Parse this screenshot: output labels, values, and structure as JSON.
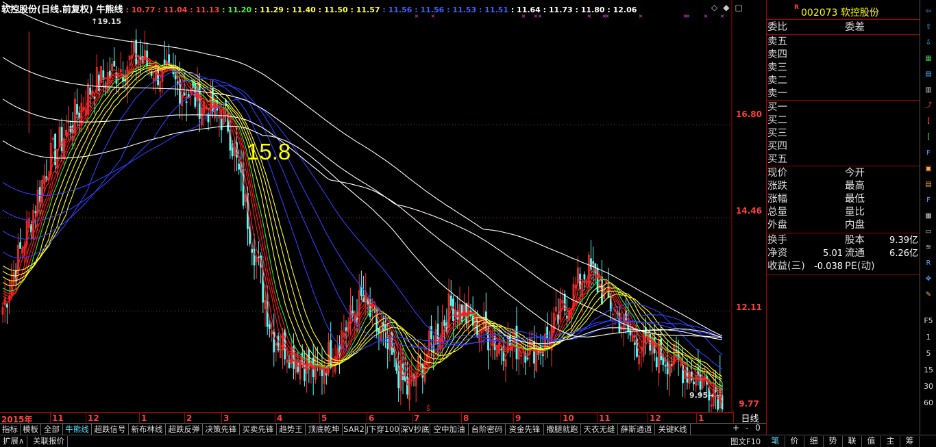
{
  "chart_title": {
    "name": "软控股份(日线.前复权) 牛熊线",
    "ma_values": [
      {
        "text": "10.77",
        "color": "#ff4040"
      },
      {
        "text": "11.04",
        "color": "#ff4040"
      },
      {
        "text": "11.13",
        "color": "#ff4040"
      },
      {
        "text": "11.20",
        "color": "#40ff40"
      },
      {
        "text": "11.29",
        "color": "#ffff40"
      },
      {
        "text": "11.40",
        "color": "#ffff40"
      },
      {
        "text": "11.50",
        "color": "#ffff40"
      },
      {
        "text": "11.57",
        "color": "#ffff40"
      },
      {
        "text": "11.56",
        "color": "#4060ff"
      },
      {
        "text": "11.56",
        "color": "#4060ff"
      },
      {
        "text": "11.53",
        "color": "#4060ff"
      },
      {
        "text": "11.51",
        "color": "#4060ff"
      },
      {
        "text": "11.64",
        "color": "#ffffff"
      },
      {
        "text": "11.73",
        "color": "#ffffff"
      },
      {
        "text": "11.80",
        "color": "#ffffff"
      },
      {
        "text": "12.06",
        "color": "#ffffff"
      }
    ]
  },
  "chart_controls": {
    "diamond": "◇",
    "diamond_filled": "◆",
    "square": "□"
  },
  "big_label": "15.8",
  "peak_label": "19.15",
  "low_label": "9.95",
  "price_axis": [
    "16.80",
    "14.46",
    "12.11",
    "9.77"
  ],
  "date_axis": [
    "2015年",
    "11",
    "12",
    "1",
    "2",
    "3",
    "4",
    "5",
    "6",
    "7",
    "8",
    "9",
    "10",
    "11",
    "12",
    "1"
  ],
  "period": "日线",
  "chart_data": {
    "type": "candlestick",
    "title": "软控股份(日线.前复权) 牛熊线",
    "ylim": [
      9.77,
      19.6
    ],
    "y_ticks": [
      9.77,
      12.11,
      14.46,
      16.8
    ],
    "high": 19.15,
    "low": 9.95,
    "x_labels": [
      "2015年",
      "11",
      "12",
      "1",
      "2",
      "3",
      "4",
      "5",
      "6",
      "7",
      "8",
      "9",
      "10",
      "11",
      "12",
      "1"
    ],
    "ma_last": [
      10.77,
      11.04,
      11.13,
      11.2,
      11.29,
      11.4,
      11.5,
      11.57,
      11.56,
      11.56,
      11.53,
      11.51,
      11.64,
      11.73,
      11.8,
      12.06
    ],
    "key_closes": [
      12.2,
      15.8,
      17.8,
      18.5,
      17.7,
      16.9,
      11.5,
      10.5,
      12.4,
      10.1,
      12.3,
      11.3,
      11.2,
      13.2,
      11.4,
      10.8,
      10.0
    ]
  },
  "tabs": [
    "指标",
    "模板",
    "全部",
    "牛熊线",
    "超跌信号",
    "新布林线",
    "超跌反弹",
    "决策先锋",
    "买卖先锋",
    "趋势王",
    "顶底乾坤",
    "SAR2",
    "J下穿100",
    "深V抄底",
    "空中加油",
    "台阶密码",
    "资金先锋",
    "撒腿就跑",
    "天衣无缝",
    "薛斯通道",
    "关键K线"
  ],
  "tab_nav": [
    "+",
    "-",
    "0"
  ],
  "bottom_buttons": [
    "扩展∧",
    "关联报价"
  ],
  "fig_button": "图文F10",
  "panel_tabs": [
    "笔",
    "价",
    "细",
    "势",
    "联",
    "值",
    "主",
    "筹"
  ],
  "stock": {
    "r": "R",
    "code": "002073",
    "name": "软控股份"
  },
  "order_header": {
    "left": "委比",
    "right": "委差"
  },
  "sell": [
    "卖五",
    "卖四",
    "卖三",
    "卖二",
    "卖一"
  ],
  "buy": [
    "买一",
    "买二",
    "买三",
    "买四",
    "买五"
  ],
  "quote_rows": [
    {
      "l": "现价",
      "r": "今开"
    },
    {
      "l": "涨跌",
      "r": "最高"
    },
    {
      "l": "涨幅",
      "r": "最低"
    },
    {
      "l": "总量",
      "r": "量比"
    },
    {
      "l": "外盘",
      "r": "内盘"
    }
  ],
  "fin_rows": [
    {
      "l": "换手",
      "v1": "",
      "r": "股本",
      "v2": "9.39亿"
    },
    {
      "l": "净资",
      "v1": "5.01",
      "r": "流通",
      "v2": "6.26亿"
    },
    {
      "l": "收益(三)",
      "v1": "-0.038",
      "r": "PE(动)",
      "v2": ""
    }
  ],
  "toolbar_text": [
    "F5",
    "1",
    "5",
    "15",
    "30",
    "60"
  ]
}
